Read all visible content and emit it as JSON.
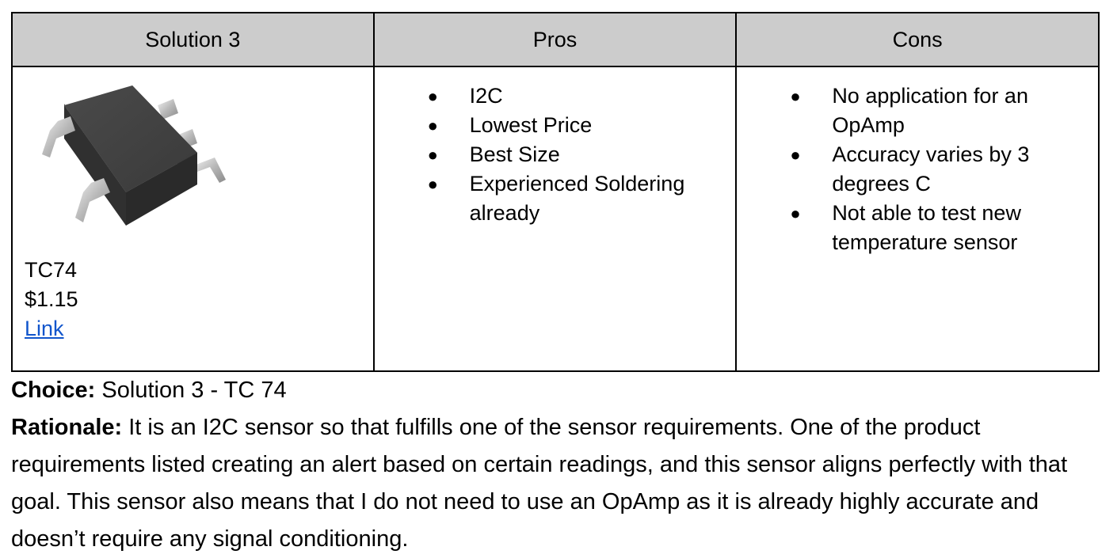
{
  "table": {
    "headers": {
      "solution": "Solution 3",
      "pros": "Pros",
      "cons": "Cons"
    },
    "solution": {
      "image_description": "TC74 chip package",
      "part_name": "TC74",
      "price": "$1.15",
      "link_label": "Link"
    },
    "pros": [
      "I2C",
      "Lowest Price",
      "Best Size",
      "Experienced Soldering already"
    ],
    "cons": [
      "No application for an OpAmp",
      "Accuracy varies by 3 degrees C",
      "Not able to test new temperature sensor"
    ],
    "bullet_char": "●"
  },
  "choice": {
    "label": "Choice:",
    "text": " Solution 3 - TC 74"
  },
  "rationale": {
    "label": "Rationale:",
    "text": " It is an I2C sensor so that fulfills one of the sensor requirements. One of the product requirements listed creating an alert based on certain readings, and this sensor aligns perfectly with that goal. This sensor also means that I do not need to use an OpAmp as it is already highly accurate and doesn’t require any signal conditioning."
  },
  "colors": {
    "header_bg": "#cccccc",
    "border": "#000000",
    "link": "#1155cc"
  }
}
